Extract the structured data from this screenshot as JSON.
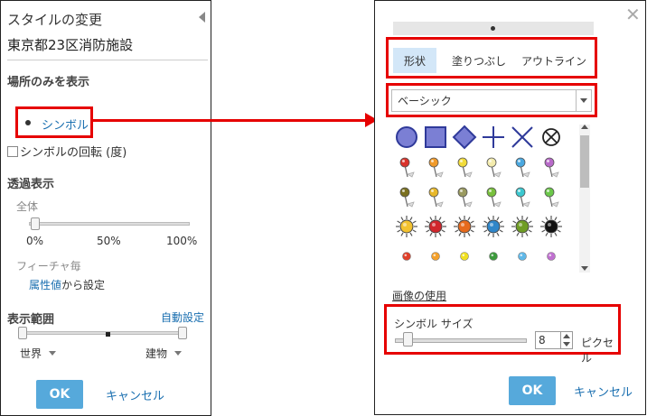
{
  "left_panel": {
    "title": "スタイルの変更",
    "layer_name": "東京都23区消防施設",
    "show_location_only": "場所のみを表示",
    "symbol_link": "シンボル",
    "rotation_label": "シンボルの回転 (度)",
    "transparency_title": "透過表示",
    "overall_label": "全体",
    "ticks": [
      "0%",
      "50%",
      "100%"
    ],
    "transparency_value_percent": 0,
    "per_feature_label": "フィーチャ毎",
    "attribute_link": "属性値",
    "attribute_suffix": "から設定",
    "visible_range_title": "表示範囲",
    "auto_set_link": "自動設定",
    "range_min_label": "世界",
    "range_max_label": "建物",
    "ok_label": "OK",
    "cancel_label": "キャンセル"
  },
  "right_panel": {
    "tabs": [
      {
        "label": "形状",
        "active": true
      },
      {
        "label": "塗りつぶし",
        "active": false
      },
      {
        "label": "アウトライン",
        "active": false
      }
    ],
    "style_select_value": "ベーシック",
    "use_image_link": "画像の使用",
    "symbol_size_label": "シンボル サイズ",
    "symbol_size_value": "8",
    "size_unit": "ピクセル",
    "ok_label": "OK",
    "cancel_label": "キャンセル",
    "symbol_rows": [
      [
        {
          "shape": "circle",
          "name": "circle-symbol-icon"
        },
        {
          "shape": "square",
          "name": "square-symbol-icon"
        },
        {
          "shape": "diamond",
          "name": "diamond-symbol-icon"
        },
        {
          "shape": "cross",
          "name": "cross-symbol-icon"
        },
        {
          "shape": "x",
          "name": "x-symbol-icon"
        },
        {
          "shape": "circle-x",
          "name": "circled-x-symbol-icon"
        }
      ],
      [
        {
          "shape": "pin",
          "color": "#d9332b",
          "name": "red-pin-icon"
        },
        {
          "shape": "pin",
          "color": "#f09a2a",
          "name": "orange-pin-icon"
        },
        {
          "shape": "pin",
          "color": "#f2dc3b",
          "name": "yellow-pin-icon"
        },
        {
          "shape": "pin",
          "color": "#f4ecae",
          "name": "cream-pin-icon"
        },
        {
          "shape": "pin",
          "color": "#4aa8e0",
          "name": "blue-pin-icon"
        },
        {
          "shape": "pin",
          "color": "#b86ac9",
          "name": "purple-pin-icon"
        }
      ],
      [
        {
          "shape": "pin",
          "color": "#7a7020",
          "name": "olive-pin-icon"
        },
        {
          "shape": "pin",
          "color": "#e8b82a",
          "name": "gold-pin-icon"
        },
        {
          "shape": "pin",
          "color": "#9a9a60",
          "name": "khaki-pin-icon"
        },
        {
          "shape": "pin",
          "color": "#78c03c",
          "name": "green-pin-icon"
        },
        {
          "shape": "pin",
          "color": "#3cc8d0",
          "name": "cyan-pin-icon"
        },
        {
          "shape": "pin",
          "color": "#6cc84a",
          "name": "lime-pin-icon"
        }
      ],
      [
        {
          "shape": "sun",
          "color": "#f3c230",
          "name": "yellow-sun-icon"
        },
        {
          "shape": "sun",
          "color": "#d0262c",
          "name": "red-sun-icon"
        },
        {
          "shape": "sun",
          "color": "#e66a1c",
          "name": "orange-sun-icon"
        },
        {
          "shape": "sun",
          "color": "#2f86c9",
          "name": "blue-sun-icon"
        },
        {
          "shape": "sun",
          "color": "#6f9d24",
          "name": "green-sun-icon"
        },
        {
          "shape": "sun",
          "color": "#111111",
          "name": "black-sun-icon"
        }
      ],
      [
        {
          "shape": "dot",
          "color": "#e0402a",
          "name": "red-dot-icon"
        },
        {
          "shape": "dot",
          "color": "#f4a02a",
          "name": "orange-dot-icon"
        },
        {
          "shape": "dot",
          "color": "#f0e020",
          "name": "yellow-dot-icon"
        },
        {
          "shape": "dot",
          "color": "#3c9a3c",
          "name": "green-dot-icon"
        },
        {
          "shape": "dot",
          "color": "#60b8e8",
          "name": "lightblue-dot-icon"
        },
        {
          "shape": "dot",
          "color": "#c070d0",
          "name": "violet-dot-icon"
        }
      ]
    ]
  },
  "colors": {
    "accent_red": "#e60000",
    "link_blue": "#1a6fb0",
    "button_blue": "#56a9db",
    "shape_fill": "#7b7fd4",
    "shape_stroke": "#2f3a9a"
  }
}
